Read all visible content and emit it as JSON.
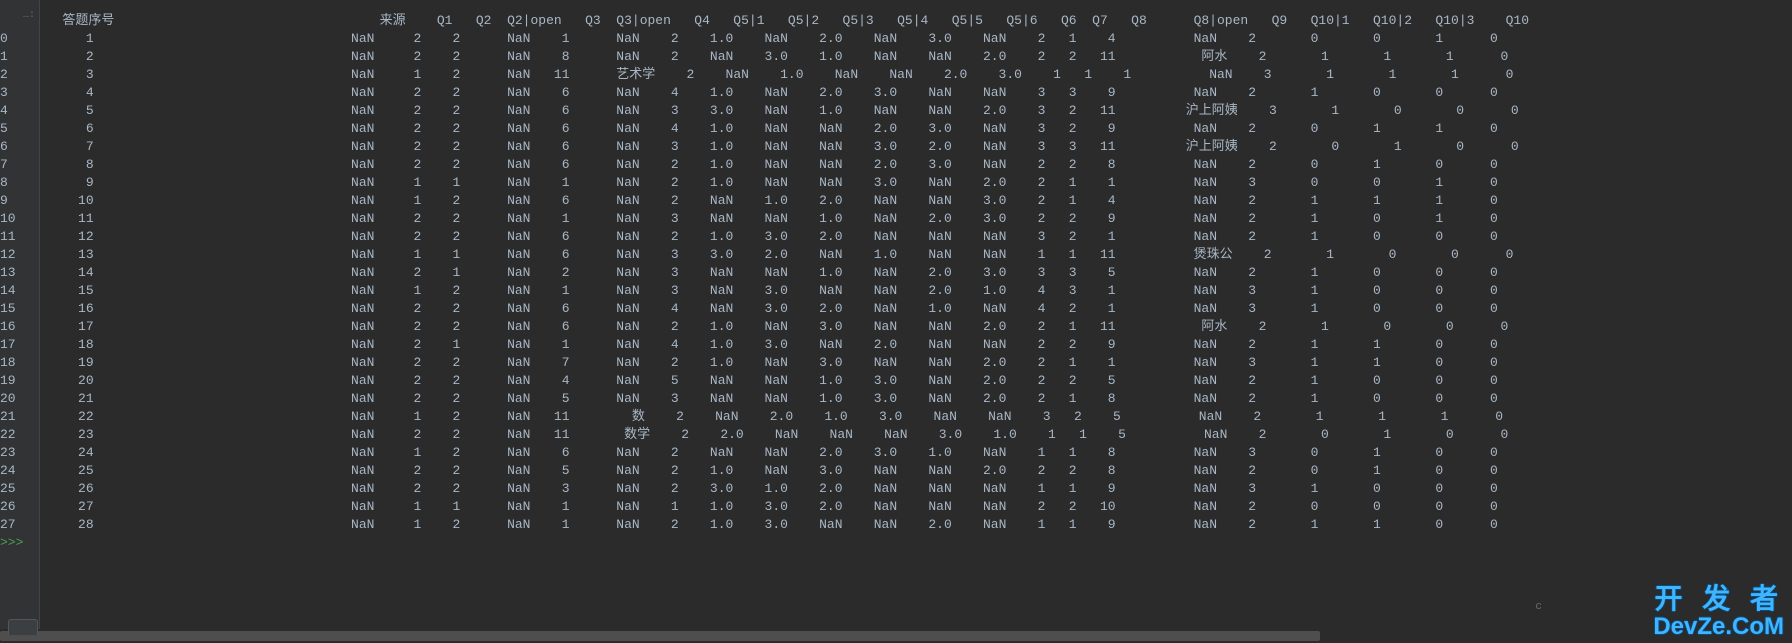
{
  "prompt": ">>>",
  "gutter_indicator": "…:",
  "headers": [
    "",
    "答题序号",
    "来源",
    "Q1",
    "Q2",
    "Q2|open",
    "Q3",
    "Q3|open",
    "Q4",
    "Q5|1",
    "Q5|2",
    "Q5|3",
    "Q5|4",
    "Q5|5",
    "Q5|6",
    "Q6",
    "Q7",
    "Q8",
    "Q8|open",
    "Q9",
    "Q10|1",
    "Q10|2",
    "Q10|3",
    "Q10"
  ],
  "rows": [
    {
      "idx": "0",
      "seq": "1",
      "src": "NaN",
      "q1": "2",
      "q2": "2",
      "q2o": "NaN",
      "q3": "1",
      "q3o": "NaN",
      "q4": "2",
      "q51": "1.0",
      "q52": "NaN",
      "q53": "2.0",
      "q54": "NaN",
      "q55": "3.0",
      "q56": "NaN",
      "q6": "2",
      "q7": "1",
      "q8": "4",
      "q8o": "NaN",
      "q9": "2",
      "q101": "0",
      "q102": "0",
      "q103": "1",
      "q10": "0"
    },
    {
      "idx": "1",
      "seq": "2",
      "src": "NaN",
      "q1": "2",
      "q2": "2",
      "q2o": "NaN",
      "q3": "8",
      "q3o": "NaN",
      "q4": "2",
      "q51": "NaN",
      "q52": "3.0",
      "q53": "1.0",
      "q54": "NaN",
      "q55": "NaN",
      "q56": "2.0",
      "q6": "2",
      "q7": "2",
      "q8": "11",
      "q8o": "阿水",
      "q9": "2",
      "q101": "1",
      "q102": "1",
      "q103": "1",
      "q10": "0"
    },
    {
      "idx": "2",
      "seq": "3",
      "src": "NaN",
      "q1": "1",
      "q2": "2",
      "q2o": "NaN",
      "q3": "11",
      "q3o": "艺术学",
      "q4": "2",
      "q51": "NaN",
      "q52": "1.0",
      "q53": "NaN",
      "q54": "NaN",
      "q55": "2.0",
      "q56": "3.0",
      "q6": "1",
      "q7": "1",
      "q8": "1",
      "q8o": "NaN",
      "q9": "3",
      "q101": "1",
      "q102": "1",
      "q103": "1",
      "q10": "0"
    },
    {
      "idx": "3",
      "seq": "4",
      "src": "NaN",
      "q1": "2",
      "q2": "2",
      "q2o": "NaN",
      "q3": "6",
      "q3o": "NaN",
      "q4": "4",
      "q51": "1.0",
      "q52": "NaN",
      "q53": "2.0",
      "q54": "3.0",
      "q55": "NaN",
      "q56": "NaN",
      "q6": "3",
      "q7": "3",
      "q8": "9",
      "q8o": "NaN",
      "q9": "2",
      "q101": "1",
      "q102": "0",
      "q103": "0",
      "q10": "0"
    },
    {
      "idx": "4",
      "seq": "5",
      "src": "NaN",
      "q1": "2",
      "q2": "2",
      "q2o": "NaN",
      "q3": "6",
      "q3o": "NaN",
      "q4": "3",
      "q51": "3.0",
      "q52": "NaN",
      "q53": "1.0",
      "q54": "NaN",
      "q55": "NaN",
      "q56": "2.0",
      "q6": "3",
      "q7": "2",
      "q8": "11",
      "q8o": "沪上阿姨",
      "q9": "3",
      "q101": "1",
      "q102": "0",
      "q103": "0",
      "q10": "0"
    },
    {
      "idx": "5",
      "seq": "6",
      "src": "NaN",
      "q1": "2",
      "q2": "2",
      "q2o": "NaN",
      "q3": "6",
      "q3o": "NaN",
      "q4": "4",
      "q51": "1.0",
      "q52": "NaN",
      "q53": "NaN",
      "q54": "2.0",
      "q55": "3.0",
      "q56": "NaN",
      "q6": "3",
      "q7": "2",
      "q8": "9",
      "q8o": "NaN",
      "q9": "2",
      "q101": "0",
      "q102": "1",
      "q103": "1",
      "q10": "0"
    },
    {
      "idx": "6",
      "seq": "7",
      "src": "NaN",
      "q1": "2",
      "q2": "2",
      "q2o": "NaN",
      "q3": "6",
      "q3o": "NaN",
      "q4": "3",
      "q51": "1.0",
      "q52": "NaN",
      "q53": "NaN",
      "q54": "3.0",
      "q55": "2.0",
      "q56": "NaN",
      "q6": "3",
      "q7": "3",
      "q8": "11",
      "q8o": "沪上阿姨",
      "q9": "2",
      "q101": "0",
      "q102": "1",
      "q103": "0",
      "q10": "0"
    },
    {
      "idx": "7",
      "seq": "8",
      "src": "NaN",
      "q1": "2",
      "q2": "2",
      "q2o": "NaN",
      "q3": "6",
      "q3o": "NaN",
      "q4": "2",
      "q51": "1.0",
      "q52": "NaN",
      "q53": "NaN",
      "q54": "2.0",
      "q55": "3.0",
      "q56": "NaN",
      "q6": "2",
      "q7": "2",
      "q8": "8",
      "q8o": "NaN",
      "q9": "2",
      "q101": "0",
      "q102": "1",
      "q103": "0",
      "q10": "0"
    },
    {
      "idx": "8",
      "seq": "9",
      "src": "NaN",
      "q1": "1",
      "q2": "1",
      "q2o": "NaN",
      "q3": "1",
      "q3o": "NaN",
      "q4": "2",
      "q51": "1.0",
      "q52": "NaN",
      "q53": "NaN",
      "q54": "3.0",
      "q55": "NaN",
      "q56": "2.0",
      "q6": "2",
      "q7": "1",
      "q8": "1",
      "q8o": "NaN",
      "q9": "3",
      "q101": "0",
      "q102": "0",
      "q103": "1",
      "q10": "0"
    },
    {
      "idx": "9",
      "seq": "10",
      "src": "NaN",
      "q1": "1",
      "q2": "2",
      "q2o": "NaN",
      "q3": "6",
      "q3o": "NaN",
      "q4": "2",
      "q51": "NaN",
      "q52": "1.0",
      "q53": "2.0",
      "q54": "NaN",
      "q55": "NaN",
      "q56": "3.0",
      "q6": "2",
      "q7": "1",
      "q8": "4",
      "q8o": "NaN",
      "q9": "2",
      "q101": "1",
      "q102": "1",
      "q103": "1",
      "q10": "0"
    },
    {
      "idx": "10",
      "seq": "11",
      "src": "NaN",
      "q1": "2",
      "q2": "2",
      "q2o": "NaN",
      "q3": "1",
      "q3o": "NaN",
      "q4": "3",
      "q51": "NaN",
      "q52": "NaN",
      "q53": "1.0",
      "q54": "NaN",
      "q55": "2.0",
      "q56": "3.0",
      "q6": "2",
      "q7": "2",
      "q8": "9",
      "q8o": "NaN",
      "q9": "2",
      "q101": "1",
      "q102": "0",
      "q103": "1",
      "q10": "0"
    },
    {
      "idx": "11",
      "seq": "12",
      "src": "NaN",
      "q1": "2",
      "q2": "2",
      "q2o": "NaN",
      "q3": "6",
      "q3o": "NaN",
      "q4": "2",
      "q51": "1.0",
      "q52": "3.0",
      "q53": "2.0",
      "q54": "NaN",
      "q55": "NaN",
      "q56": "NaN",
      "q6": "3",
      "q7": "2",
      "q8": "1",
      "q8o": "NaN",
      "q9": "2",
      "q101": "1",
      "q102": "0",
      "q103": "0",
      "q10": "0"
    },
    {
      "idx": "12",
      "seq": "13",
      "src": "NaN",
      "q1": "1",
      "q2": "1",
      "q2o": "NaN",
      "q3": "6",
      "q3o": "NaN",
      "q4": "3",
      "q51": "3.0",
      "q52": "2.0",
      "q53": "NaN",
      "q54": "1.0",
      "q55": "NaN",
      "q56": "NaN",
      "q6": "1",
      "q7": "1",
      "q8": "11",
      "q8o": "煲珠公",
      "q9": "2",
      "q101": "1",
      "q102": "0",
      "q103": "0",
      "q10": "0"
    },
    {
      "idx": "13",
      "seq": "14",
      "src": "NaN",
      "q1": "2",
      "q2": "1",
      "q2o": "NaN",
      "q3": "2",
      "q3o": "NaN",
      "q4": "3",
      "q51": "NaN",
      "q52": "NaN",
      "q53": "1.0",
      "q54": "NaN",
      "q55": "2.0",
      "q56": "3.0",
      "q6": "3",
      "q7": "3",
      "q8": "5",
      "q8o": "NaN",
      "q9": "2",
      "q101": "1",
      "q102": "0",
      "q103": "0",
      "q10": "0"
    },
    {
      "idx": "14",
      "seq": "15",
      "src": "NaN",
      "q1": "1",
      "q2": "2",
      "q2o": "NaN",
      "q3": "1",
      "q3o": "NaN",
      "q4": "3",
      "q51": "NaN",
      "q52": "3.0",
      "q53": "NaN",
      "q54": "NaN",
      "q55": "2.0",
      "q56": "1.0",
      "q6": "4",
      "q7": "3",
      "q8": "1",
      "q8o": "NaN",
      "q9": "3",
      "q101": "1",
      "q102": "0",
      "q103": "0",
      "q10": "0"
    },
    {
      "idx": "15",
      "seq": "16",
      "src": "NaN",
      "q1": "2",
      "q2": "2",
      "q2o": "NaN",
      "q3": "6",
      "q3o": "NaN",
      "q4": "4",
      "q51": "NaN",
      "q52": "3.0",
      "q53": "2.0",
      "q54": "NaN",
      "q55": "1.0",
      "q56": "NaN",
      "q6": "4",
      "q7": "2",
      "q8": "1",
      "q8o": "NaN",
      "q9": "3",
      "q101": "1",
      "q102": "0",
      "q103": "0",
      "q10": "0"
    },
    {
      "idx": "16",
      "seq": "17",
      "src": "NaN",
      "q1": "2",
      "q2": "2",
      "q2o": "NaN",
      "q3": "6",
      "q3o": "NaN",
      "q4": "2",
      "q51": "1.0",
      "q52": "NaN",
      "q53": "3.0",
      "q54": "NaN",
      "q55": "NaN",
      "q56": "2.0",
      "q6": "2",
      "q7": "1",
      "q8": "11",
      "q8o": "阿水",
      "q9": "2",
      "q101": "1",
      "q102": "0",
      "q103": "0",
      "q10": "0"
    },
    {
      "idx": "17",
      "seq": "18",
      "src": "NaN",
      "q1": "2",
      "q2": "1",
      "q2o": "NaN",
      "q3": "1",
      "q3o": "NaN",
      "q4": "4",
      "q51": "1.0",
      "q52": "3.0",
      "q53": "NaN",
      "q54": "2.0",
      "q55": "NaN",
      "q56": "NaN",
      "q6": "2",
      "q7": "2",
      "q8": "9",
      "q8o": "NaN",
      "q9": "2",
      "q101": "1",
      "q102": "1",
      "q103": "0",
      "q10": "0"
    },
    {
      "idx": "18",
      "seq": "19",
      "src": "NaN",
      "q1": "2",
      "q2": "2",
      "q2o": "NaN",
      "q3": "7",
      "q3o": "NaN",
      "q4": "2",
      "q51": "1.0",
      "q52": "NaN",
      "q53": "3.0",
      "q54": "NaN",
      "q55": "NaN",
      "q56": "2.0",
      "q6": "2",
      "q7": "1",
      "q8": "1",
      "q8o": "NaN",
      "q9": "3",
      "q101": "1",
      "q102": "1",
      "q103": "0",
      "q10": "0"
    },
    {
      "idx": "19",
      "seq": "20",
      "src": "NaN",
      "q1": "2",
      "q2": "2",
      "q2o": "NaN",
      "q3": "4",
      "q3o": "NaN",
      "q4": "5",
      "q51": "NaN",
      "q52": "NaN",
      "q53": "1.0",
      "q54": "3.0",
      "q55": "NaN",
      "q56": "2.0",
      "q6": "2",
      "q7": "2",
      "q8": "5",
      "q8o": "NaN",
      "q9": "2",
      "q101": "1",
      "q102": "0",
      "q103": "0",
      "q10": "0"
    },
    {
      "idx": "20",
      "seq": "21",
      "src": "NaN",
      "q1": "2",
      "q2": "2",
      "q2o": "NaN",
      "q3": "5",
      "q3o": "NaN",
      "q4": "3",
      "q51": "NaN",
      "q52": "NaN",
      "q53": "1.0",
      "q54": "3.0",
      "q55": "NaN",
      "q56": "2.0",
      "q6": "2",
      "q7": "1",
      "q8": "8",
      "q8o": "NaN",
      "q9": "2",
      "q101": "1",
      "q102": "0",
      "q103": "0",
      "q10": "0"
    },
    {
      "idx": "21",
      "seq": "22",
      "src": "NaN",
      "q1": "1",
      "q2": "2",
      "q2o": "NaN",
      "q3": "11",
      "q3o": "数",
      "q4": "2",
      "q51": "NaN",
      "q52": "2.0",
      "q53": "1.0",
      "q54": "3.0",
      "q55": "NaN",
      "q56": "NaN",
      "q6": "3",
      "q7": "2",
      "q8": "5",
      "q8o": "NaN",
      "q9": "2",
      "q101": "1",
      "q102": "1",
      "q103": "1",
      "q10": "0"
    },
    {
      "idx": "22",
      "seq": "23",
      "src": "NaN",
      "q1": "2",
      "q2": "2",
      "q2o": "NaN",
      "q3": "11",
      "q3o": "数学",
      "q4": "2",
      "q51": "2.0",
      "q52": "NaN",
      "q53": "NaN",
      "q54": "NaN",
      "q55": "3.0",
      "q56": "1.0",
      "q6": "1",
      "q7": "1",
      "q8": "5",
      "q8o": "NaN",
      "q9": "2",
      "q101": "0",
      "q102": "1",
      "q103": "0",
      "q10": "0"
    },
    {
      "idx": "23",
      "seq": "24",
      "src": "NaN",
      "q1": "1",
      "q2": "2",
      "q2o": "NaN",
      "q3": "6",
      "q3o": "NaN",
      "q4": "2",
      "q51": "NaN",
      "q52": "NaN",
      "q53": "2.0",
      "q54": "3.0",
      "q55": "1.0",
      "q56": "NaN",
      "q6": "1",
      "q7": "1",
      "q8": "8",
      "q8o": "NaN",
      "q9": "3",
      "q101": "0",
      "q102": "1",
      "q103": "0",
      "q10": "0"
    },
    {
      "idx": "24",
      "seq": "25",
      "src": "NaN",
      "q1": "2",
      "q2": "2",
      "q2o": "NaN",
      "q3": "5",
      "q3o": "NaN",
      "q4": "2",
      "q51": "1.0",
      "q52": "NaN",
      "q53": "3.0",
      "q54": "NaN",
      "q55": "NaN",
      "q56": "2.0",
      "q6": "2",
      "q7": "2",
      "q8": "8",
      "q8o": "NaN",
      "q9": "2",
      "q101": "0",
      "q102": "1",
      "q103": "0",
      "q10": "0"
    },
    {
      "idx": "25",
      "seq": "26",
      "src": "NaN",
      "q1": "2",
      "q2": "2",
      "q2o": "NaN",
      "q3": "3",
      "q3o": "NaN",
      "q4": "2",
      "q51": "3.0",
      "q52": "1.0",
      "q53": "2.0",
      "q54": "NaN",
      "q55": "NaN",
      "q56": "NaN",
      "q6": "1",
      "q7": "1",
      "q8": "9",
      "q8o": "NaN",
      "q9": "3",
      "q101": "1",
      "q102": "0",
      "q103": "0",
      "q10": "0"
    },
    {
      "idx": "26",
      "seq": "27",
      "src": "NaN",
      "q1": "1",
      "q2": "1",
      "q2o": "NaN",
      "q3": "1",
      "q3o": "NaN",
      "q4": "1",
      "q51": "1.0",
      "q52": "3.0",
      "q53": "2.0",
      "q54": "NaN",
      "q55": "NaN",
      "q56": "NaN",
      "q6": "2",
      "q7": "2",
      "q8": "10",
      "q8o": "NaN",
      "q9": "2",
      "q101": "0",
      "q102": "0",
      "q103": "0",
      "q10": "0"
    },
    {
      "idx": "27",
      "seq": "28",
      "src": "NaN",
      "q1": "1",
      "q2": "2",
      "q2o": "NaN",
      "q3": "1",
      "q3o": "NaN",
      "q4": "2",
      "q51": "1.0",
      "q52": "3.0",
      "q53": "NaN",
      "q54": "NaN",
      "q55": "2.0",
      "q56": "NaN",
      "q6": "1",
      "q7": "1",
      "q8": "9",
      "q8o": "NaN",
      "q9": "2",
      "q101": "1",
      "q102": "1",
      "q103": "0",
      "q10": "0"
    }
  ],
  "watermark": {
    "top": "开 发 者",
    "bottom": "DevZe.CoM"
  }
}
